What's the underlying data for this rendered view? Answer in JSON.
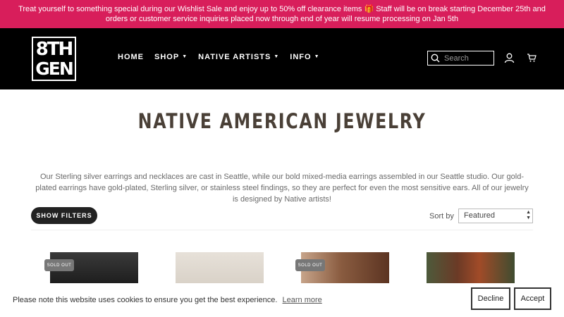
{
  "announcement": "Treat yourself to something special during our Wishlist Sale and enjoy up to 50% off clearance items 🎁 Staff will be on break starting December 25th and orders or customer service inquiries placed now through end of year will resume processing on Jan 5th",
  "logo": {
    "line1": "8TH",
    "line2": "GEN"
  },
  "nav": [
    {
      "label": "HOME",
      "dropdown": false
    },
    {
      "label": "SHOP",
      "dropdown": true
    },
    {
      "label": "NATIVE ARTISTS",
      "dropdown": true
    },
    {
      "label": "INFO",
      "dropdown": true
    }
  ],
  "caret": "▼",
  "search": {
    "placeholder": "Search"
  },
  "icons": {
    "search": "search-icon",
    "account": "user-icon",
    "cart": "cart-icon"
  },
  "page_title": "NATIVE AMERICAN JEWELRY",
  "description": "Our Sterling silver earrings and necklaces are cast in Seattle, while our bold mixed-media earrings assembled in our Seattle studio. Our gold-plated earrings have gold-plated, Sterling silver, or stainless steel findings, so they are perfect for even the most sensitive ears. All of our jewelry is designed by Native artists!",
  "filters_button": "SHOW FILTERS",
  "sort": {
    "label": "Sort by",
    "value": "Featured"
  },
  "products": [
    {
      "badge": "SOLD OUT"
    },
    {
      "badge": ""
    },
    {
      "badge": "SOLD OUT"
    },
    {
      "badge": ""
    }
  ],
  "cookie": {
    "text": "Please note this website uses cookies to ensure you get the best experience.",
    "link": "Learn more",
    "decline": "Decline",
    "accept": "Accept"
  },
  "colors": {
    "announcement_bg": "#d81e5b",
    "header_bg": "#000000",
    "title": "#4a4037"
  }
}
